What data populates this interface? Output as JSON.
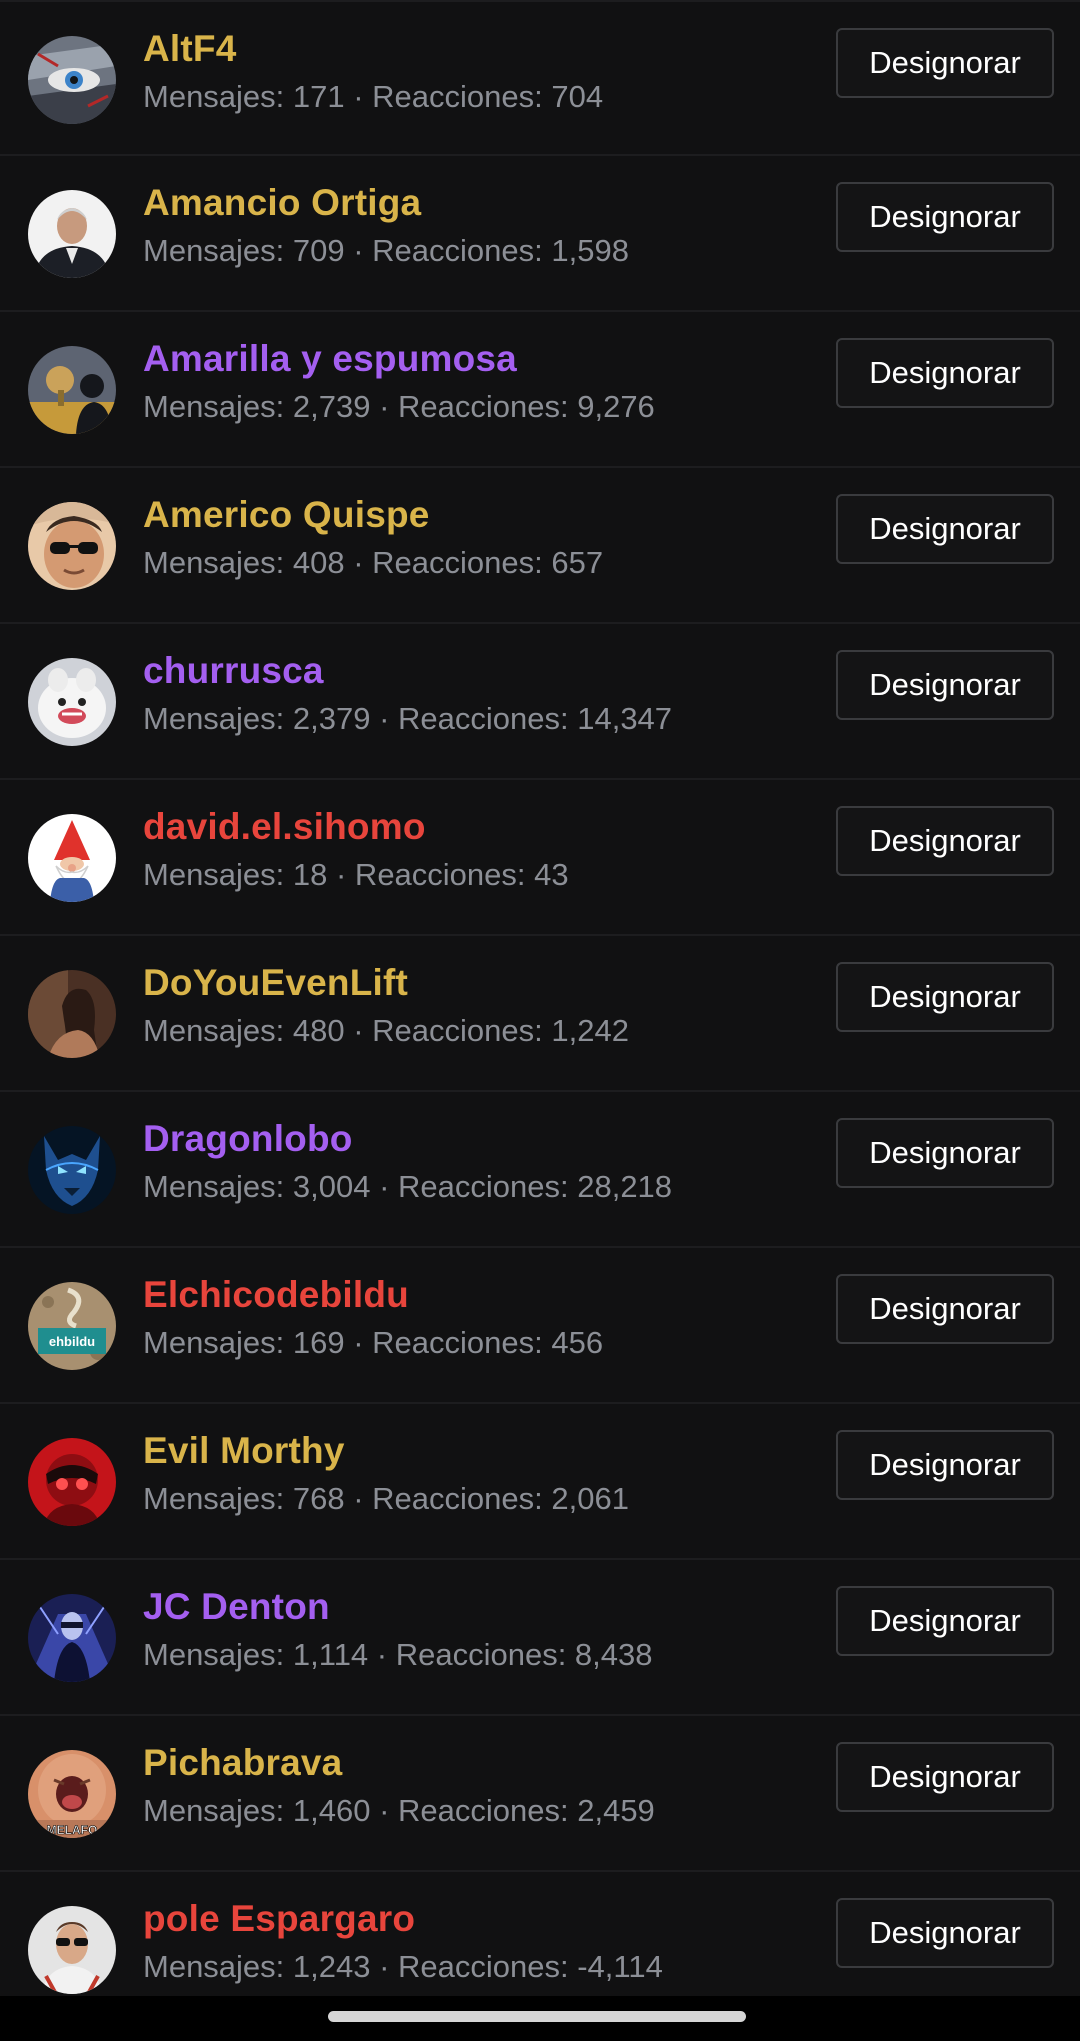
{
  "users": [
    {
      "name": "AltF4",
      "stats": "Mensajes: 171 · Reacciones: 704",
      "name_color": "#d9b44a",
      "avatar_icon": "eye-portrait",
      "button_label": "Designorar"
    },
    {
      "name": "Amancio Ortiga",
      "stats": "Mensajes: 709 · Reacciones: 1,598",
      "name_color": "#d9b44a",
      "avatar_icon": "man-in-suit",
      "button_label": "Designorar"
    },
    {
      "name": "Amarilla y espumosa",
      "stats": "Mensajes: 2,739 · Reacciones: 9,276",
      "name_color": "#a45ff0",
      "avatar_icon": "silhouette-scene",
      "button_label": "Designorar"
    },
    {
      "name": "Americo Quispe",
      "stats": "Mensajes: 408 · Reacciones: 657",
      "name_color": "#d9b44a",
      "avatar_icon": "face-sunglasses",
      "button_label": "Designorar"
    },
    {
      "name": "churrusca",
      "stats": "Mensajes: 2,379 · Reacciones: 14,347",
      "name_color": "#a45ff0",
      "avatar_icon": "white-dog",
      "button_label": "Designorar"
    },
    {
      "name": "david.el.sihomo",
      "stats": "Mensajes: 18 · Reacciones: 43",
      "name_color": "#e8453c",
      "avatar_icon": "gnome",
      "button_label": "Designorar"
    },
    {
      "name": "DoYouEvenLift",
      "stats": "Mensajes: 480 · Reacciones: 1,242",
      "name_color": "#d9b44a",
      "avatar_icon": "portrait",
      "button_label": "Designorar"
    },
    {
      "name": "Dragonlobo",
      "stats": "Mensajes: 3,004 · Reacciones: 28,218",
      "name_color": "#a45ff0",
      "avatar_icon": "blue-wolf",
      "button_label": "Designorar"
    },
    {
      "name": "Elchicodebildu",
      "stats": "Mensajes: 169 · Reacciones: 456",
      "name_color": "#e8453c",
      "avatar_icon": "ehbildu-logo",
      "avatar_text": "ehbildu",
      "button_label": "Designorar"
    },
    {
      "name": "Evil Morthy",
      "stats": "Mensajes: 768 · Reacciones: 2,061",
      "name_color": "#d9b44a",
      "avatar_icon": "red-character",
      "button_label": "Designorar"
    },
    {
      "name": "JC Denton",
      "stats": "Mensajes: 1,114 · Reacciones: 8,438",
      "name_color": "#a45ff0",
      "avatar_icon": "cyber-figure",
      "button_label": "Designorar"
    },
    {
      "name": "Pichabrava",
      "stats": "Mensajes: 1,460 · Reacciones: 2,459",
      "name_color": "#d9b44a",
      "avatar_icon": "shouting-face",
      "avatar_text": "MELAFO",
      "button_label": "Designorar"
    },
    {
      "name": "pole Espargaro",
      "stats": "Mensajes: 1,243 · Reacciones: -4,114",
      "name_color": "#e8453c",
      "avatar_icon": "man-sunglasses",
      "button_label": "Designorar"
    }
  ]
}
